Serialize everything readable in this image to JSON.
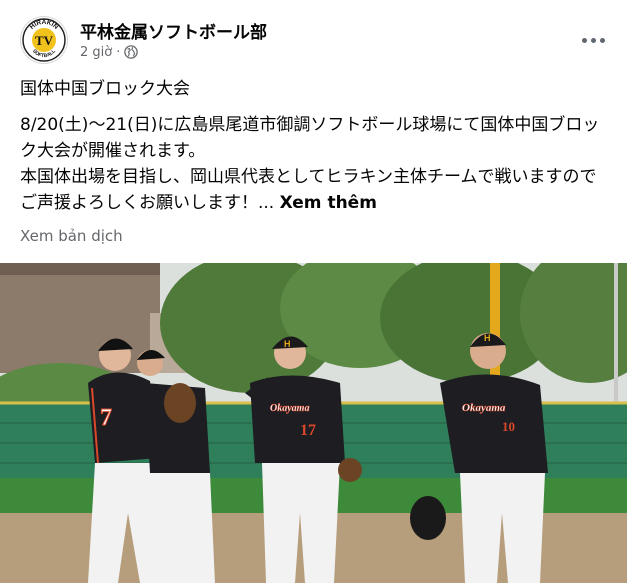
{
  "post": {
    "page_name": "平林金属ソフトボール部",
    "timestamp": "2 giờ",
    "more_icon": "more-horizontal-icon",
    "privacy_icon": "globe-icon",
    "logo": {
      "arc_top": "HIRAKIN",
      "arc_bottom": "SOFTBALL",
      "mark": "TV"
    },
    "text": {
      "title": "国体中国ブロック大会",
      "line1": "8/20(土)〜21(日)に広島県尾道市御調ソフトボール球場にて国体中国ブロック大会が開催されます。",
      "line2": "本国体出場を目指し、岡山県代表としてヒラキン主体チームで戦いますのでご声援よろしくお願いします！...",
      "see_more": "Xem thêm"
    },
    "translate_label": "Xem bản dịch"
  },
  "photo": {
    "jerseys": {
      "team_name": "Okayama",
      "numbers": [
        "7",
        "17",
        "10"
      ],
      "cap_letter": "H"
    },
    "colors": {
      "jersey": "#1d1d22",
      "jersey_trim": "#d9482b",
      "pants": "#f2f2f2",
      "grass": "#3d8a3a",
      "dirt": "#b69d7b",
      "fence": "#2f7f5a"
    }
  }
}
